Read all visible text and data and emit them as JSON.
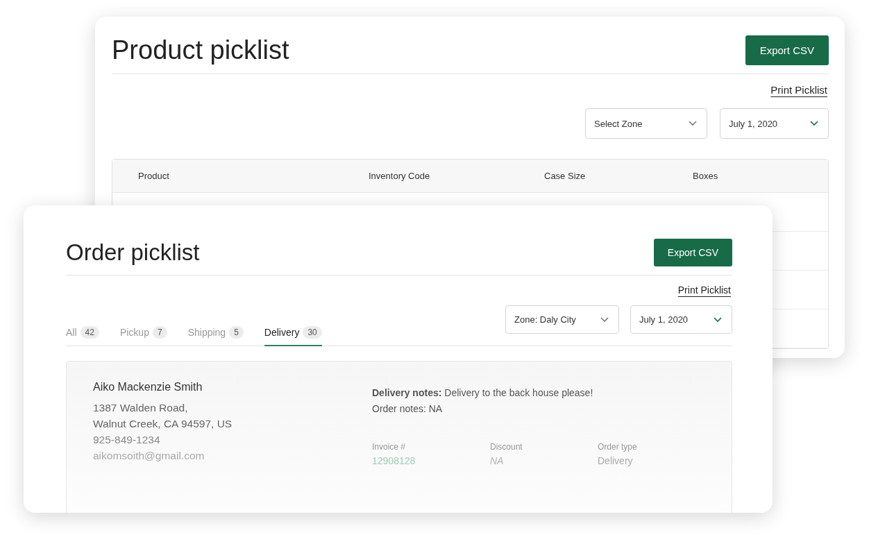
{
  "product_picklist": {
    "title": "Product picklist",
    "export_button": "Export CSV",
    "print_link": "Print Picklist",
    "selects": [
      {
        "kind": "zone",
        "value": "Select Zone"
      },
      {
        "kind": "date",
        "value": "July 1, 2020"
      }
    ],
    "table": {
      "columns": [
        "Product",
        "Inventory Code",
        "Case Size",
        "Boxes"
      ]
    }
  },
  "order_picklist": {
    "title": "Order picklist",
    "export_button": "Export CSV",
    "print_link": "Print Picklist",
    "tabs": [
      {
        "label": "All",
        "count": "42",
        "selected": false
      },
      {
        "label": "Pickup",
        "count": "7",
        "selected": false
      },
      {
        "label": "Shipping",
        "count": "5",
        "selected": false
      },
      {
        "label": "Delivery",
        "count": "30",
        "selected": true
      }
    ],
    "selects": [
      {
        "kind": "zone",
        "value": "Zone: Daly City"
      },
      {
        "kind": "date",
        "value": "July 1, 2020"
      }
    ],
    "order": {
      "name": "Aiko Mackenzie Smith",
      "address": [
        "1387 Walden Road,",
        "Walnut Creek, CA 94597, US"
      ],
      "phone": "925-849-1234",
      "email": "aikomsoith@gmail.com",
      "notes": [
        "**Delivery notes:** Delivery to the back house please!",
        "Order notes: NA"
      ],
      "fields": [
        {
          "label": "Invoice #",
          "value": "12908128",
          "kind": "link"
        },
        {
          "label": "Discount",
          "value": "NA",
          "kind": "empty"
        },
        {
          "label": "Order type",
          "value": "Delivery",
          "kind": "text"
        }
      ]
    }
  }
}
